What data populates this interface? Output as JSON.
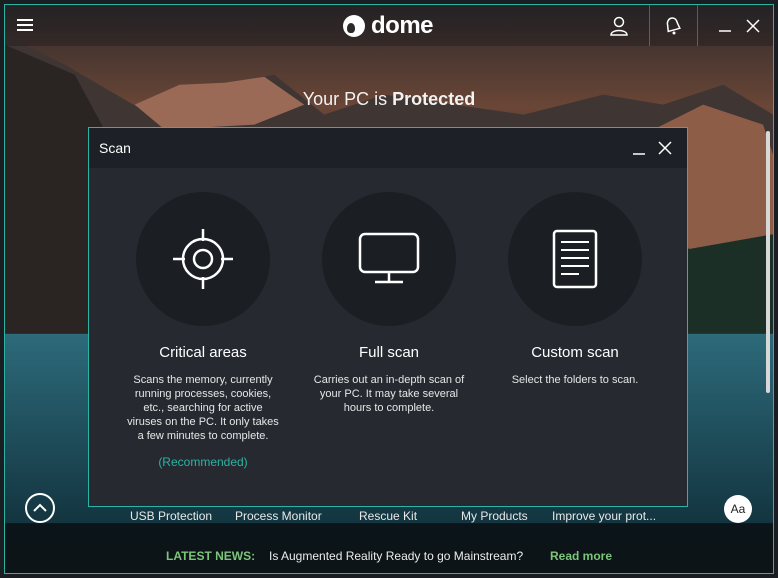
{
  "app": {
    "logo_text": "dome"
  },
  "status": {
    "prefix": "Your PC is",
    "state": "Protected"
  },
  "dialog": {
    "title": "Scan",
    "options": [
      {
        "title": "Critical areas",
        "description": "Scans the memory, currently running processes, cookies, etc., searching for active viruses on the PC. It only takes a few minutes to complete.",
        "note": "(Recommended)",
        "icon": "crosshair-icon"
      },
      {
        "title": "Full scan",
        "description": "Carries out an in-depth scan of your PC. It may take several hours to complete.",
        "icon": "monitor-icon"
      },
      {
        "title": "Custom scan",
        "description": "Select the folders to scan.",
        "icon": "document-icon"
      }
    ]
  },
  "bottom_nav": {
    "items": [
      "USB Protection",
      "Process Monitor",
      "Rescue Kit",
      "My Products",
      "Improve your prot..."
    ],
    "font_button": "Aa"
  },
  "news": {
    "label": "LATEST NEWS:",
    "headline": "Is Augmented Reality Ready to go Mainstream?",
    "link": "Read more"
  },
  "colors": {
    "accent": "#2bb3a3",
    "news_green": "#7bc67a",
    "dialog_bg": "#262a30"
  }
}
